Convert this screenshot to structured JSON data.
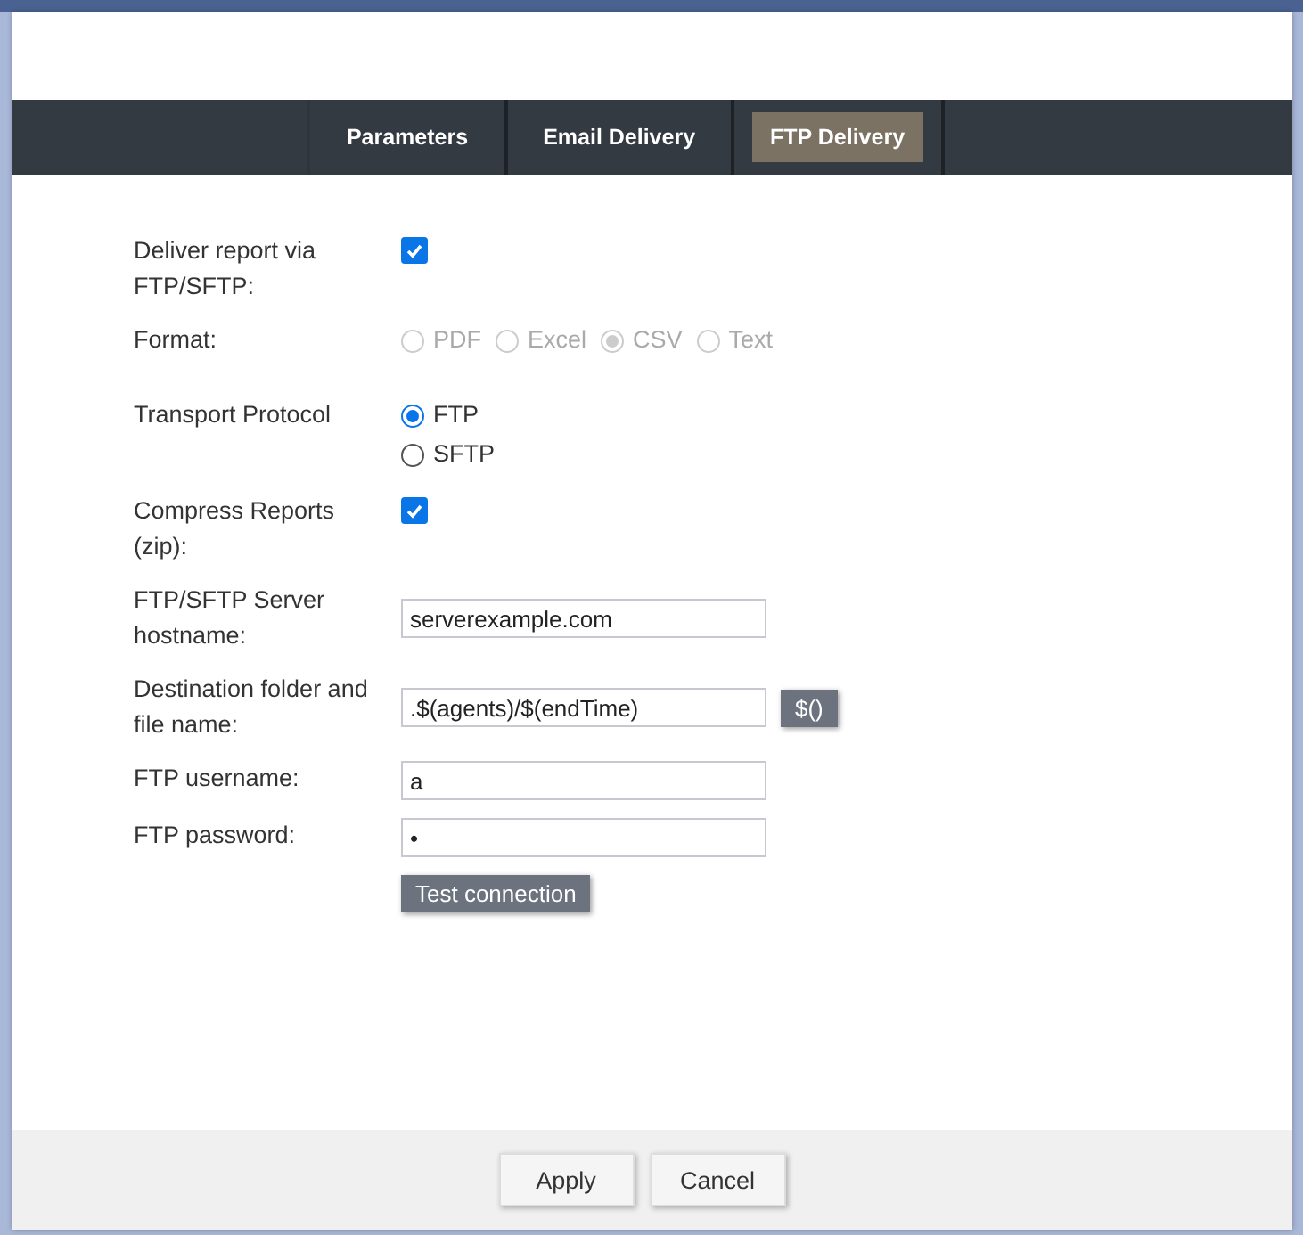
{
  "tabs": [
    {
      "label": "Parameters",
      "selected": false
    },
    {
      "label": "Email Delivery",
      "selected": false
    },
    {
      "label": "FTP Delivery",
      "selected": true
    }
  ],
  "form": [
    {
      "kind": "checkbox",
      "label": "Deliver report via FTP/SFTP:",
      "checked": true
    },
    {
      "kind": "radio_row",
      "label": "Format:",
      "disabled": true,
      "options": [
        {
          "label": "PDF",
          "selected": false
        },
        {
          "label": "Excel",
          "selected": false
        },
        {
          "label": "CSV",
          "selected": true
        },
        {
          "label": "Text",
          "selected": false
        }
      ]
    },
    {
      "kind": "radio_list",
      "label": "Transport Protocol",
      "disabled": false,
      "options": [
        {
          "label": "FTP",
          "selected": true
        },
        {
          "label": "SFTP",
          "selected": false
        }
      ]
    },
    {
      "kind": "checkbox",
      "label": "Compress Reports (zip):",
      "checked": true
    },
    {
      "kind": "text",
      "label": "FTP/SFTP Server hostname:",
      "value": "serverexample.com"
    },
    {
      "kind": "text",
      "label": "Destination folder and file name:",
      "value": ".$(agents)/$(endTime)",
      "button": "$()"
    },
    {
      "kind": "text",
      "label": "FTP username:",
      "value": "a"
    },
    {
      "kind": "text",
      "label": "FTP password:",
      "value": "•"
    },
    {
      "kind": "button",
      "label": "Test connection"
    }
  ],
  "buttons": [
    "Apply",
    "Cancel"
  ]
}
